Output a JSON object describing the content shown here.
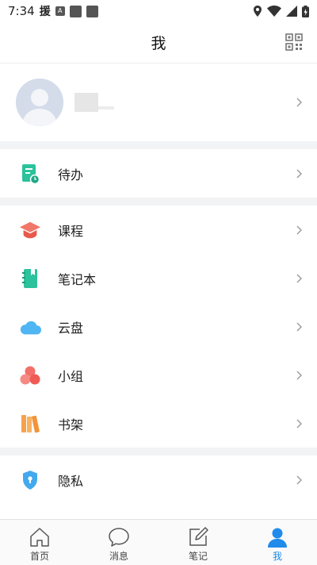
{
  "status_bar": {
    "time": "7:34",
    "app_char": "援",
    "notif_letter": "A"
  },
  "header": {
    "title": "我",
    "qr_icon": "qr-code-icon"
  },
  "profile": {
    "avatar_icon": "default-avatar-icon"
  },
  "menu": {
    "todo": "待办",
    "course": "课程",
    "notebook": "笔记本",
    "cloud": "云盘",
    "group": "小组",
    "bookshelf": "书架",
    "privacy": "隐私"
  },
  "tabs": [
    {
      "label": "首页",
      "icon": "home-icon"
    },
    {
      "label": "消息",
      "icon": "message-icon"
    },
    {
      "label": "笔记",
      "icon": "note-edit-icon"
    },
    {
      "label": "我",
      "icon": "person-icon"
    }
  ],
  "colors": {
    "accent": "#1f8ceb",
    "todo_green": "#2bc29c",
    "course_red": "#f1776b",
    "cloud_blue": "#4fb5f3",
    "group_pink": "#f36f6a",
    "shelf_orange": "#f7a24a",
    "privacy_blue": "#43a9ee"
  }
}
